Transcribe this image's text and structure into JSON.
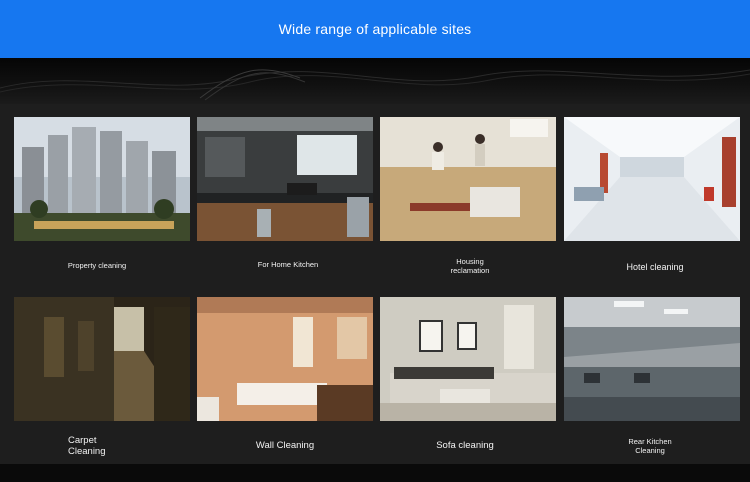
{
  "header": {
    "title": "Wide range of applicable sites"
  },
  "sites": [
    {
      "label": "Property cleaning",
      "image": "residential-towers-photo"
    },
    {
      "label": "For Home Kitchen",
      "image": "home-kitchen-photo"
    },
    {
      "label": "Housing\nreclamation",
      "image": "housing-renovation-photo"
    },
    {
      "label": "Hotel cleaning",
      "image": "hotel-corridor-photo"
    },
    {
      "label": "Carpet\nCleaning",
      "image": "carpeted-hallway-photo"
    },
    {
      "label": "Wall Cleaning",
      "image": "tiled-bathroom-photo"
    },
    {
      "label": "Sofa cleaning",
      "image": "living-room-sofa-photo"
    },
    {
      "label": "Rear Kitchen\nCleaning",
      "image": "commercial-kitchen-photo"
    }
  ],
  "colors": {
    "banner": "#1677f0",
    "panel": "#1e1e1e",
    "background": "#0c0c0c",
    "text": "#f2f2f2"
  }
}
